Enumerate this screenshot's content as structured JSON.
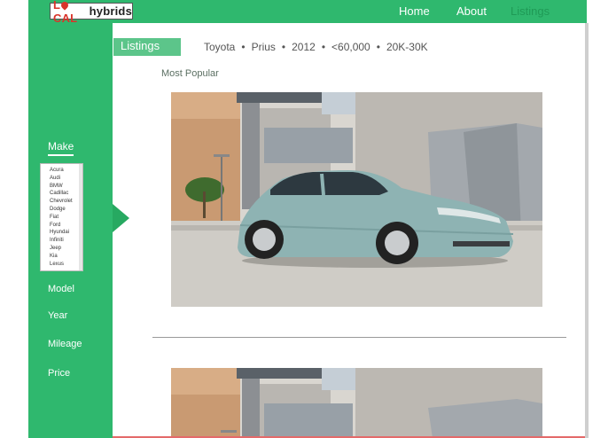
{
  "header": {
    "logo": {
      "local": "L",
      "local_rest": "CAL",
      "hybrids": "hybrids"
    },
    "nav": [
      "Home",
      "About",
      "Listings"
    ]
  },
  "sidebar": {
    "make_label": "Make",
    "makes": [
      "Acura",
      "Audi",
      "BMW",
      "Cadillac",
      "Chevrolet",
      "Dodge",
      "Fiat",
      "Ford",
      "Hyundai",
      "Infiniti",
      "Jeep",
      "Kia",
      "Lexus"
    ],
    "items": [
      "Model",
      "Year",
      "Mileage",
      "Price"
    ]
  },
  "main": {
    "tab_label": "Listings",
    "filters": [
      "Toyota",
      "Prius",
      "2012",
      "<60,000",
      "20K-30K"
    ],
    "section_title": "Most Popular"
  },
  "colors": {
    "brand_green": "#2fb86e",
    "accent_red": "#d9342b"
  }
}
